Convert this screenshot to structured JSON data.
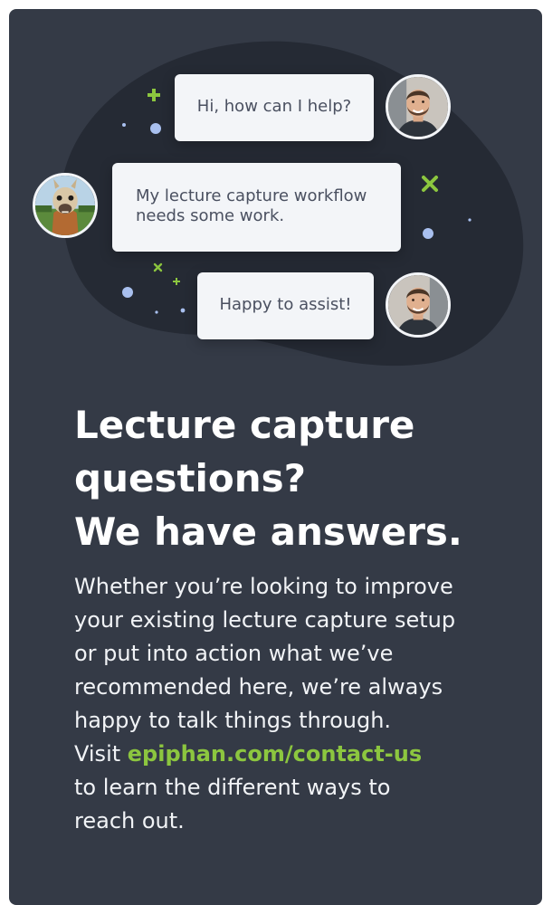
{
  "colors": {
    "card_background": "#343a46",
    "blob": "#252a34",
    "bubble": "#f3f5f8",
    "accent_green": "#8cc63f",
    "dot_blue": "#a9c0ef"
  },
  "chat": {
    "bubble_1": "Hi, how can I help?",
    "bubble_2_line_1": "My lecture capture workflow",
    "bubble_2_line_2": "needs some work.",
    "bubble_3": "Happy to assist!"
  },
  "heading": {
    "line_1": "Lecture capture",
    "line_2": "questions?",
    "line_3": "We have answers."
  },
  "body": {
    "line_1": "Whether you’re looking to improve",
    "line_2": "your existing lecture capture setup",
    "line_3": "or put into action what we’ve",
    "line_4": "recommended here, we’re always",
    "line_5": "happy to talk things through.",
    "visit_prefix": "Visit ",
    "link_text": "epiphan.com/contact-us",
    "line_7": "to learn the different ways to",
    "line_8": "reach out."
  },
  "icons": {
    "agent_avatar": "smiling-man-avatar",
    "user_avatar": "llama-avatar",
    "decor_plus": "plus-sparkle-icon",
    "decor_cross": "cross-sparkle-icon"
  }
}
